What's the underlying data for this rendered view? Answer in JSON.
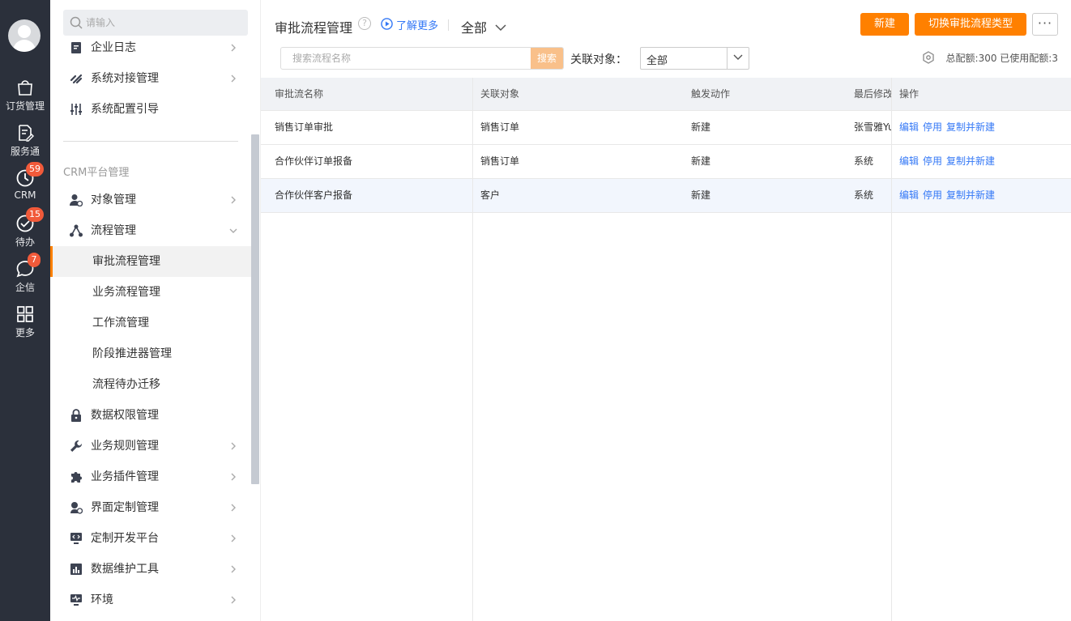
{
  "rail": {
    "items": [
      {
        "label": "订货管理",
        "icon": "shopping-bag-icon"
      },
      {
        "label": "服务通",
        "icon": "service-edit-icon"
      },
      {
        "label": "CRM",
        "icon": "crm-clock-icon",
        "badge": "59"
      },
      {
        "label": "待办",
        "icon": "check-circle-icon",
        "badge": "15"
      },
      {
        "label": "企信",
        "icon": "chat-bubble-icon",
        "badge": "7"
      },
      {
        "label": "更多",
        "icon": "grid-icon"
      }
    ]
  },
  "sidebar": {
    "search_placeholder": "请输入",
    "top_items": [
      {
        "label": "企业日志",
        "icon": "log-icon"
      },
      {
        "label": "系统对接管理",
        "icon": "link-icon"
      },
      {
        "label": "系统配置引导",
        "icon": "sliders-icon"
      }
    ],
    "section_title": "CRM平台管理",
    "items": [
      {
        "label": "对象管理",
        "icon": "user-gear-icon"
      },
      {
        "label": "流程管理",
        "icon": "flow-icon"
      },
      {
        "label": "审批流程管理"
      },
      {
        "label": "业务流程管理"
      },
      {
        "label": "工作流管理"
      },
      {
        "label": "阶段推进器管理"
      },
      {
        "label": "流程待办迁移"
      },
      {
        "label": "数据权限管理",
        "icon": "lock-icon"
      },
      {
        "label": "业务规则管理",
        "icon": "wrench-icon"
      },
      {
        "label": "业务插件管理",
        "icon": "puzzle-icon"
      },
      {
        "label": "界面定制管理",
        "icon": "ui-custom-icon"
      },
      {
        "label": "定制开发平台",
        "icon": "code-monitor-icon"
      },
      {
        "label": "数据维护工具",
        "icon": "chart-bars-icon"
      },
      {
        "label": "环境",
        "icon": "monitor-pulse-icon"
      }
    ]
  },
  "header": {
    "title": "审批流程管理",
    "help": "?",
    "learn_more": "了解更多",
    "scope": "全部",
    "new_button": "新建",
    "switch_button": "切换审批流程类型",
    "more_button": "···"
  },
  "filters": {
    "search_placeholder": "搜索流程名称",
    "search_button": "搜索",
    "related_label": "关联对象：",
    "related_value": "全部",
    "quota": "总配额:300 已使用配额:3"
  },
  "table": {
    "headers": [
      "审批流名称",
      "关联对象",
      "触发动作",
      "最后修改",
      "操作"
    ],
    "rows": [
      {
        "name": "销售订单审批",
        "object": "销售订单",
        "action": "新建",
        "modifier": "张雪雅Yuki"
      },
      {
        "name": "合作伙伴订单报备",
        "object": "销售订单",
        "action": "新建",
        "modifier": "系统"
      },
      {
        "name": "合作伙伴客户报备",
        "object": "客户",
        "action": "新建",
        "modifier": "系统"
      }
    ],
    "actions": [
      "编辑",
      "停用",
      "复制并新建"
    ]
  }
}
